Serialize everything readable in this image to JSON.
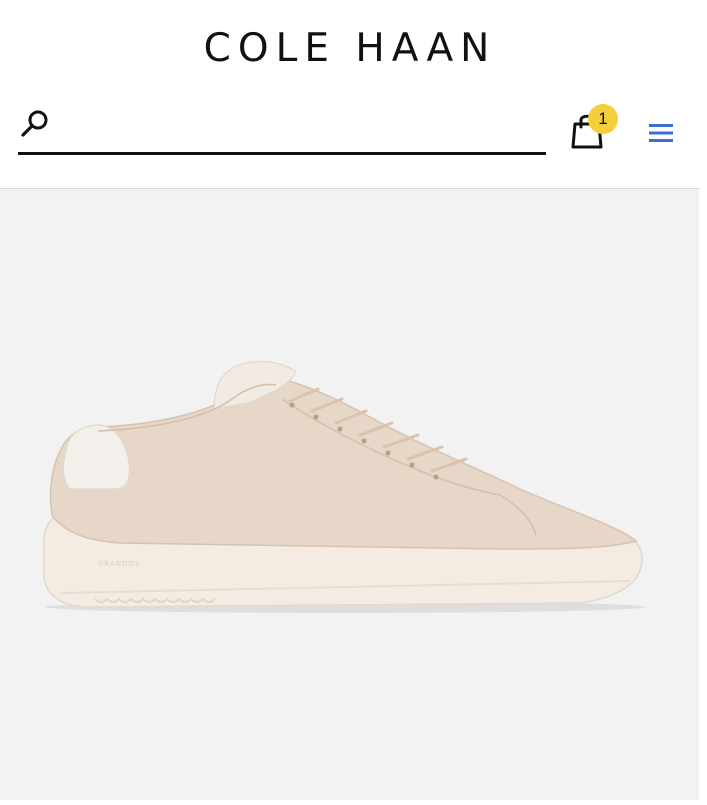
{
  "header": {
    "brand": "COLE HAAN",
    "search": {
      "placeholder": "",
      "value": ""
    },
    "cart": {
      "count": "1",
      "badge_color": "#f5cf3b"
    },
    "menu": {
      "icon": "hamburger-menu-icon",
      "color": "#3a6fd1"
    }
  },
  "product": {
    "image": "white leather sneaker with cream sole",
    "sole_embossing": "GRANDOS"
  },
  "colors": {
    "image_background": "#f2f2f2",
    "upper": "#e7d7c8",
    "sole": "#f4ece2"
  }
}
